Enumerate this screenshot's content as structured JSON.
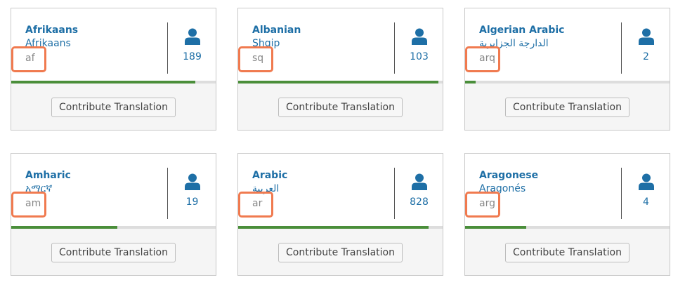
{
  "button_label": "Contribute Translation",
  "colors": {
    "link": "#1e6fa6",
    "code": "#888888",
    "progress": "#4a8e3a",
    "highlight": "#f07a4f"
  },
  "cards": [
    {
      "name": "Afrikaans",
      "native": "Afrikaans",
      "code": "af",
      "contributors": "189",
      "progress": 0.9
    },
    {
      "name": "Albanian",
      "native": "Shqip",
      "code": "sq",
      "contributors": "103",
      "progress": 0.98
    },
    {
      "name": "Algerian Arabic",
      "native": "الدارجة الجزايرية",
      "code": "arq",
      "contributors": "2",
      "progress": 0.05
    },
    {
      "name": "Amharic",
      "native": "አማርኛ",
      "code": "am",
      "contributors": "19",
      "progress": 0.52
    },
    {
      "name": "Arabic",
      "native": "العربية",
      "code": "ar",
      "contributors": "828",
      "progress": 0.93
    },
    {
      "name": "Aragonese",
      "native": "Aragonés",
      "code": "arg",
      "contributors": "4",
      "progress": 0.3
    }
  ]
}
